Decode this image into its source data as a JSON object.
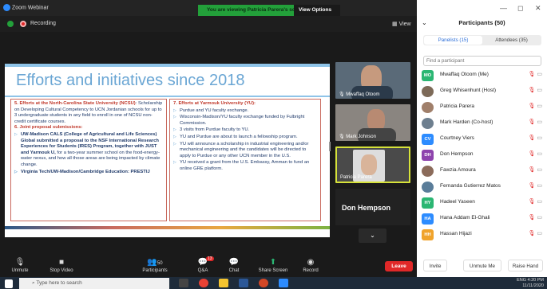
{
  "window": {
    "app_title": "Zoom Webinar",
    "banner_text": "You are viewing Patricia Parera's screen",
    "view_options": "View Options ⌄",
    "recording_label": "Recording",
    "view_label": "View",
    "minimize": "—",
    "maximize": "◻",
    "close": "✕"
  },
  "slide": {
    "title": "Efforts and initiatives since 2018",
    "left": {
      "item5_head": "5. Efforts at the North-Carolina State University (NCSU)",
      "item5_body": ": Scholarship on Developing Cultural Competency to UCN Jordanian schools for up to 3 undergraduate students in any field to enroll in one of NCSU non-credit certificate courses.",
      "item6_head": "6. Joint proposal submissions:",
      "bullet1_bold": "UW-Madison CALS (College of Agricultural and Life Sciences) Global submitted a proposal to the NSF International Research Experiences for Students (IRES) Program, together with JUST and Yarmouk U,",
      "bullet1_rest": " for a two-year summer school on the food-energy-water nexus, and how all those areas are being impacted by climate change.",
      "bullet2": "Virginia Tech/UW-Madison/Cambridge Education: PRESTIJ"
    },
    "right": {
      "item7_head": "7. Efforts at Yarmouk University (YU):",
      "bullets": [
        "Purdue and YU faculty exchange.",
        "Wisconsin-Madison/YU faculty exchange funded by Fulbright Commission.",
        "3 visits from Purdue faculty to YU.",
        "YU and Purdue are about to launch a fellowship program.",
        "YU will announce a scholarship in industrial engineering and/or mechanical engineering and the candidates will be directed to apply to Purdue or any other UCN member in the U.S.",
        "YU received a grant from the U.S. Embassy, Amman to fund an online GRE platform."
      ]
    }
  },
  "videos": {
    "tile1": "Mwaffaq Otoom",
    "tile2": "Mark Johnson",
    "tile3": "Patricia Parera",
    "tile4": "Don Hempson"
  },
  "toolbar": {
    "unmute": "Unmute",
    "stop_video": "Stop Video",
    "participants": "Participants",
    "participants_count": "50",
    "qa": "Q&A",
    "qa_badge": "13",
    "chat": "Chat",
    "share": "Share Screen",
    "record": "Record",
    "leave": "Leave"
  },
  "panel": {
    "title": "Participants (50)",
    "tab_panelists": "Panelists (15)",
    "tab_attendees": "Attendees (35)",
    "search_placeholder": "Find a participant",
    "participants": [
      {
        "initials": "MO",
        "name": "Mwaffaq Otoom (Me)",
        "color": "#2bb673",
        "photo": false
      },
      {
        "initials": "",
        "name": "Greg Whisenhunt (Host)",
        "color": "#7d6a58",
        "photo": true
      },
      {
        "initials": "",
        "name": "Patricia Parera",
        "color": "#a07f6a",
        "photo": true
      },
      {
        "initials": "",
        "name": "Mark Harden (Co-host)",
        "color": "#6e7f8f",
        "photo": true
      },
      {
        "initials": "CV",
        "name": "Courtney Viers",
        "color": "#2d8cff",
        "photo": false
      },
      {
        "initials": "DH",
        "name": "Don Hempson",
        "color": "#8e44ad",
        "photo": false
      },
      {
        "initials": "",
        "name": "Fawzia Amoura",
        "color": "#8b6b5a",
        "photo": true
      },
      {
        "initials": "",
        "name": "Fernanda Gutierrez Matos",
        "color": "#5a7d9a",
        "photo": true
      },
      {
        "initials": "HY",
        "name": "Hadeel Yaseen",
        "color": "#2bb673",
        "photo": false
      },
      {
        "initials": "HA",
        "name": "Hana Addam El-Ghali",
        "color": "#2d8cff",
        "photo": false
      },
      {
        "initials": "HH",
        "name": "Hassan Hijazi",
        "color": "#f0a32b",
        "photo": false
      }
    ],
    "invite": "Invite",
    "unmute_me": "Unmute Me",
    "raise_hand": "Raise Hand"
  },
  "taskbar": {
    "search_placeholder": "Type here to search",
    "time": "4:20 PM",
    "date": "11/11/2020",
    "lang": "ENG"
  }
}
